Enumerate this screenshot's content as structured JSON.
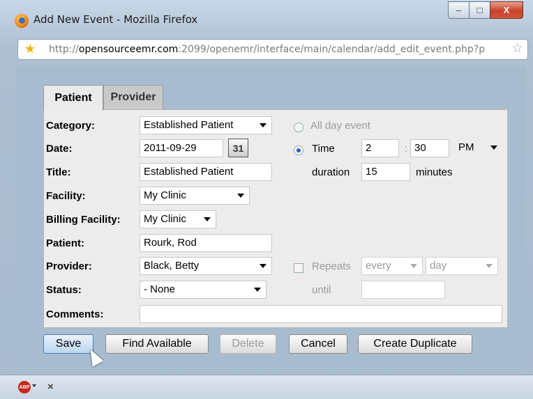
{
  "window": {
    "title": "Add New Event - Mozilla Firefox",
    "min": "‒",
    "max": "□",
    "close": "X"
  },
  "browser": {
    "url_prefix": "http://",
    "url_domain": "opensourceemr.com",
    "url_rest": ":2099/openemr/interface/main/calendar/add_edit_event.php?p"
  },
  "tabs": {
    "patient": "Patient",
    "provider": "Provider"
  },
  "labels": {
    "category": "Category:",
    "date": "Date:",
    "title": "Title:",
    "facility": "Facility:",
    "billing_facility": "Billing Facility:",
    "patient": "Patient:",
    "provider": "Provider:",
    "status": "Status:",
    "comments": "Comments:"
  },
  "values": {
    "category": "Established Patient",
    "date": "2011-09-29",
    "title": "Established Patient",
    "facility": "My Clinic",
    "billing_facility": "My Clinic",
    "patient": "Rourk, Rod",
    "provider": "Black, Betty",
    "status": "- None",
    "comments": ""
  },
  "right": {
    "all_day": "All day event",
    "time": "Time",
    "hour": "2",
    "colon": ":",
    "minute": "30",
    "ampm": "PM",
    "duration": "duration",
    "duration_value": "15",
    "minutes": "minutes",
    "repeats": "Repeats",
    "repeat_every": "every",
    "repeat_unit": "day",
    "until": "until",
    "until_value": ""
  },
  "buttons": {
    "save": "Save",
    "find_available": "Find Available",
    "delete": "Delete",
    "cancel": "Cancel",
    "create_duplicate": "Create Duplicate"
  },
  "calendar_glyph": "31",
  "statusbar": {
    "abp": "ABP",
    "close": "×"
  }
}
